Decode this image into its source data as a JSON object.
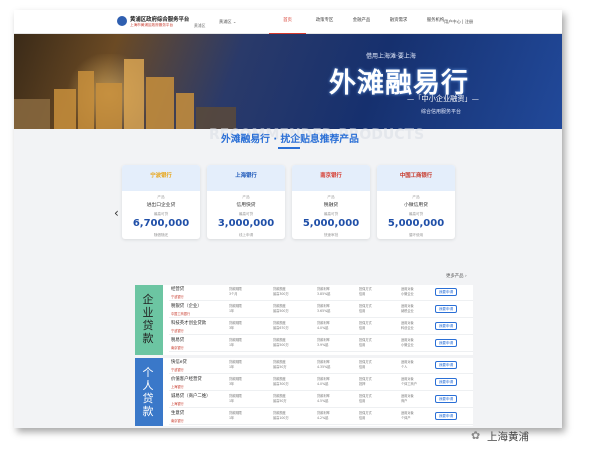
{
  "header": {
    "site_name": "黄浦区政府综合服务平台",
    "site_sub": "上海市黄浦区政府服务平台",
    "area": "黄浦区",
    "region": "黄浦区 ⌄",
    "nav": [
      "首页",
      "政策专区",
      "金融产品",
      "融资需求",
      "服务机构"
    ],
    "user": "用户中心 | 注册"
  },
  "banner": {
    "tagline": "借用上海滩·要上海",
    "title": "外滩融易行",
    "subtitle": "—「中小企业融资」—",
    "subtitle2": "综合信用服务平台"
  },
  "section": {
    "title": "外滩融易行 · 扰企贴息推荐产品",
    "watermark": "RECOMMENDED PRODUCTS"
  },
  "cards": [
    {
      "bank": "宁波银行",
      "color": "#e8a415",
      "label1": "产品",
      "product": "进出口企业贷",
      "label2": "最高可贷",
      "amount": "6,700,000",
      "extra": "随借随还"
    },
    {
      "bank": "上海银行",
      "color": "#1a56b8",
      "label1": "产品",
      "product": "信用快贷",
      "label2": "最高可贷",
      "amount": "3,000,000",
      "extra": "线上申请"
    },
    {
      "bank": "南京银行",
      "color": "#d63a2e",
      "label1": "产品",
      "product": "税融贷",
      "label2": "最高可贷",
      "amount": "5,000,000",
      "extra": "快速审批"
    },
    {
      "bank": "中国工商银行",
      "color": "#c7392b",
      "label1": "产品",
      "product": "小微信用贷",
      "label2": "最高可贷",
      "amount": "5,000,000",
      "extra": "循环使用"
    }
  ],
  "list_more": "更多产品 ›",
  "groups": [
    {
      "label": "企业贷款",
      "rows": [
        {
          "name": "经营贷",
          "bank": "宁波银行",
          "c1": "贷款期限\n3个月",
          "c2": "贷款额度\n最高300万",
          "c3": "贷款利率\n3.85%起",
          "c4": "担保方式\n信用",
          "c5": "适用对象\n小微企业",
          "btn": "我要申请"
        },
        {
          "name": "税银贷（企业）",
          "bank": "中国工商银行",
          "c1": "贷款期限\n1年",
          "c2": "贷款额度\n最高500万",
          "c3": "贷款利率\n3.65%起",
          "c4": "担保方式\n信用",
          "c5": "适用对象\n纳税企业",
          "btn": "我要申请"
        },
        {
          "name": "科技英才创业贷款",
          "bank": "宁波银行",
          "c1": "贷款期限\n3年",
          "c2": "贷款额度\n最高670万",
          "c3": "贷款利率\n4.0%起",
          "c4": "担保方式\n信用",
          "c5": "适用对象\n科创企业",
          "btn": "我要申请"
        },
        {
          "name": "税易贷",
          "bank": "南京银行",
          "c1": "贷款期限\n1年",
          "c2": "贷款额度\n最高500万",
          "c3": "贷款利率\n3.9%起",
          "c4": "担保方式\n信用",
          "c5": "适用对象\n小微企业",
          "btn": "我要申请"
        }
      ]
    },
    {
      "label": "个人贷款",
      "rows": [
        {
          "name": "快信e贷",
          "bank": "宁波银行",
          "c1": "贷款期限\n1年",
          "c2": "贷款额度\n最高50万",
          "c3": "贷款利率\n4.35%起",
          "c4": "担保方式\n信用",
          "c5": "适用对象\n个人",
          "btn": "我要申请"
        },
        {
          "name": "价值客户经营贷",
          "bank": "上海银行",
          "c1": "贷款期限\n3年",
          "c2": "贷款额度\n最高300万",
          "c3": "贷款利率\n4.0%起",
          "c4": "担保方式\n抵押",
          "c5": "适用对象\n个体工商户",
          "btn": "我要申请"
        },
        {
          "name": "诚易贷（商户二维）",
          "bank": "上海银行",
          "c1": "贷款期限\n1年",
          "c2": "贷款额度\n最高50万",
          "c3": "贷款利率\n4.5%起",
          "c4": "担保方式\n信用",
          "c5": "适用对象\n商户",
          "btn": "我要申请"
        },
        {
          "name": "生意贷",
          "bank": "南京银行",
          "c1": "贷款期限\n1年",
          "c2": "贷款额度\n最高100万",
          "c3": "贷款利率\n4.2%起",
          "c4": "担保方式\n信用",
          "c5": "适用对象\n个体户",
          "btn": "我要申请"
        }
      ]
    }
  ],
  "watermark": {
    "text": "上海黄浦",
    "icon": "wechat-icon"
  }
}
